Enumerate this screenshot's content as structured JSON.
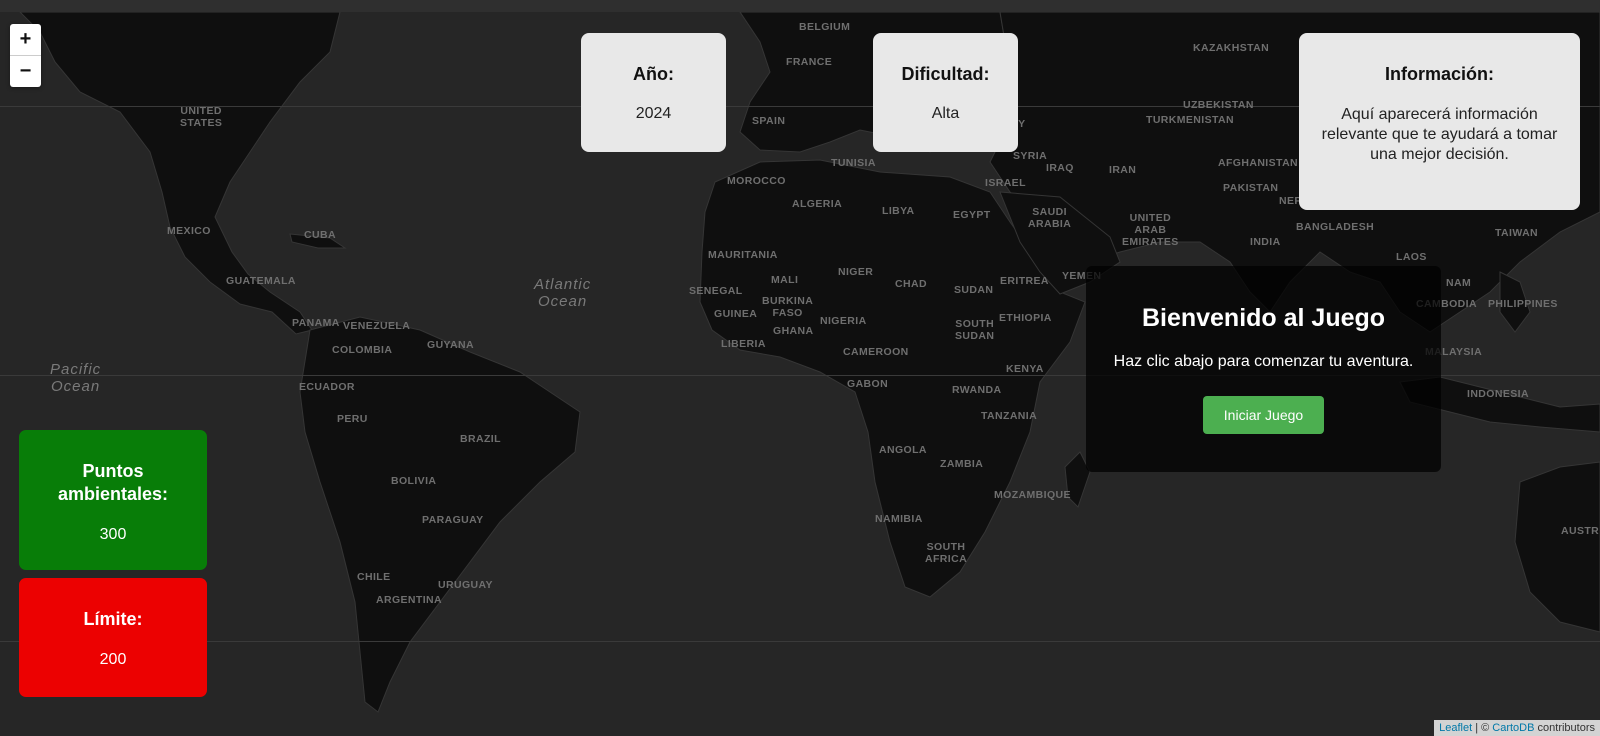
{
  "map": {
    "zoom_in_label": "+",
    "zoom_out_label": "−",
    "countries": [
      {
        "key": "united-states",
        "label": "UNITED\nSTATES",
        "l": 180,
        "t": 105
      },
      {
        "key": "mexico",
        "label": "MEXICO",
        "l": 167,
        "t": 225
      },
      {
        "key": "cuba",
        "label": "CUBA",
        "l": 304,
        "t": 229
      },
      {
        "key": "guatemala",
        "label": "GUATEMALA",
        "l": 226,
        "t": 275
      },
      {
        "key": "panama",
        "label": "PANAMA",
        "l": 292,
        "t": 317
      },
      {
        "key": "venezuela",
        "label": "VENEZUELA",
        "l": 343,
        "t": 320
      },
      {
        "key": "guyana",
        "label": "GUYANA",
        "l": 427,
        "t": 339
      },
      {
        "key": "colombia",
        "label": "COLOMBIA",
        "l": 332,
        "t": 344
      },
      {
        "key": "ecuador",
        "label": "ECUADOR",
        "l": 299,
        "t": 381
      },
      {
        "key": "peru",
        "label": "PERU",
        "l": 337,
        "t": 413
      },
      {
        "key": "brazil",
        "label": "BRAZIL",
        "l": 460,
        "t": 433
      },
      {
        "key": "bolivia",
        "label": "BOLIVIA",
        "l": 391,
        "t": 475
      },
      {
        "key": "paraguay",
        "label": "PARAGUAY",
        "l": 422,
        "t": 514
      },
      {
        "key": "uruguay",
        "label": "URUGUAY",
        "l": 438,
        "t": 579
      },
      {
        "key": "chile",
        "label": "CHILE",
        "l": 357,
        "t": 571
      },
      {
        "key": "argentina",
        "label": "ARGENTINA",
        "l": 376,
        "t": 594
      },
      {
        "key": "belgium",
        "label": "BELGIUM",
        "l": 799,
        "t": 21
      },
      {
        "key": "france",
        "label": "FRANCE",
        "l": 786,
        "t": 56
      },
      {
        "key": "spain",
        "label": "SPAIN",
        "l": 752,
        "t": 115
      },
      {
        "key": "tunisia",
        "label": "TUNISIA",
        "l": 831,
        "t": 157
      },
      {
        "key": "morocco",
        "label": "MOROCCO",
        "l": 727,
        "t": 175
      },
      {
        "key": "algeria",
        "label": "ALGERIA",
        "l": 792,
        "t": 198
      },
      {
        "key": "libya",
        "label": "LIBYA",
        "l": 882,
        "t": 205
      },
      {
        "key": "egypt",
        "label": "EGYPT",
        "l": 953,
        "t": 209
      },
      {
        "key": "mauritania",
        "label": "MAURITANIA",
        "l": 708,
        "t": 249
      },
      {
        "key": "mali",
        "label": "MALI",
        "l": 771,
        "t": 274
      },
      {
        "key": "niger",
        "label": "NIGER",
        "l": 838,
        "t": 266
      },
      {
        "key": "chad",
        "label": "CHAD",
        "l": 895,
        "t": 278
      },
      {
        "key": "sudan",
        "label": "SUDAN",
        "l": 954,
        "t": 284
      },
      {
        "key": "senegal",
        "label": "SENEGAL",
        "l": 689,
        "t": 285
      },
      {
        "key": "burkina-faso",
        "label": "BURKINA\nFASO",
        "l": 762,
        "t": 295
      },
      {
        "key": "guinea",
        "label": "GUINEA",
        "l": 714,
        "t": 308
      },
      {
        "key": "nigeria",
        "label": "NIGERIA",
        "l": 820,
        "t": 315
      },
      {
        "key": "ghana",
        "label": "GHANA",
        "l": 773,
        "t": 325
      },
      {
        "key": "liberia",
        "label": "LIBERIA",
        "l": 721,
        "t": 338
      },
      {
        "key": "cameroon",
        "label": "CAMEROON",
        "l": 843,
        "t": 346
      },
      {
        "key": "south-sudan",
        "label": "SOUTH\nSUDAN",
        "l": 955,
        "t": 318
      },
      {
        "key": "ethiopia",
        "label": "ETHIOPIA",
        "l": 999,
        "t": 312
      },
      {
        "key": "eritrea",
        "label": "ERITREA",
        "l": 1000,
        "t": 275
      },
      {
        "key": "kenya",
        "label": "KENYA",
        "l": 1006,
        "t": 363
      },
      {
        "key": "gabon",
        "label": "GABON",
        "l": 847,
        "t": 378
      },
      {
        "key": "rwanda",
        "label": "RWANDA",
        "l": 952,
        "t": 384
      },
      {
        "key": "tanzania",
        "label": "TANZANIA",
        "l": 981,
        "t": 410
      },
      {
        "key": "angola",
        "label": "ANGOLA",
        "l": 879,
        "t": 444
      },
      {
        "key": "zambia",
        "label": "ZAMBIA",
        "l": 940,
        "t": 458
      },
      {
        "key": "mozambique",
        "label": "MOZAMBIQUE",
        "l": 994,
        "t": 489
      },
      {
        "key": "namibia",
        "label": "NAMIBIA",
        "l": 875,
        "t": 513
      },
      {
        "key": "south-africa",
        "label": "SOUTH\nAFRICA",
        "l": 925,
        "t": 541
      },
      {
        "key": "turkey",
        "label": "TURKEY",
        "l": 980,
        "t": 118
      },
      {
        "key": "syria",
        "label": "SYRIA",
        "l": 1013,
        "t": 150
      },
      {
        "key": "iraq",
        "label": "IRAQ",
        "l": 1046,
        "t": 162
      },
      {
        "key": "israel",
        "label": "ISRAEL",
        "l": 985,
        "t": 177
      },
      {
        "key": "saudi-arabia",
        "label": "SAUDI\nARABIA",
        "l": 1028,
        "t": 206
      },
      {
        "key": "yemen",
        "label": "YEMEN",
        "l": 1062,
        "t": 270
      },
      {
        "key": "iran",
        "label": "IRAN",
        "l": 1109,
        "t": 164
      },
      {
        "key": "kazakhstan",
        "label": "KAZAKHSTAN",
        "l": 1193,
        "t": 42
      },
      {
        "key": "uzbekistan",
        "label": "UZBEKISTAN",
        "l": 1183,
        "t": 99
      },
      {
        "key": "turkmenistan",
        "label": "TURKMENISTAN",
        "l": 1146,
        "t": 114
      },
      {
        "key": "afghanistan",
        "label": "AFGHANISTAN",
        "l": 1218,
        "t": 157
      },
      {
        "key": "pakistan",
        "label": "PAKISTAN",
        "l": 1223,
        "t": 182
      },
      {
        "key": "nepal",
        "label": "NEPAL",
        "l": 1279,
        "t": 195
      },
      {
        "key": "uae",
        "label": "UNITED\nARAB\nEMIRATES",
        "l": 1122,
        "t": 212
      },
      {
        "key": "bangladesh",
        "label": "BANGLADESH",
        "l": 1296,
        "t": 221
      },
      {
        "key": "india",
        "label": "INDIA",
        "l": 1250,
        "t": 236
      },
      {
        "key": "laos",
        "label": "LAOS",
        "l": 1396,
        "t": 251
      },
      {
        "key": "vietnam",
        "label": "NAM",
        "l": 1446,
        "t": 277
      },
      {
        "key": "cambodia",
        "label": "CAMBODIA",
        "l": 1416,
        "t": 298
      },
      {
        "key": "malaysia",
        "label": "MALAYSIA",
        "l": 1425,
        "t": 346
      },
      {
        "key": "philippines",
        "label": "PHILIPPINES",
        "l": 1488,
        "t": 298
      },
      {
        "key": "taiwan",
        "label": "TAIWAN",
        "l": 1495,
        "t": 227
      },
      {
        "key": "indonesia",
        "label": "INDONESIA",
        "l": 1467,
        "t": 388
      },
      {
        "key": "australia",
        "label": "AUSTR",
        "l": 1561,
        "t": 525
      }
    ],
    "oceans": [
      {
        "key": "atlantic",
        "label": "Atlantic\nOcean",
        "l": 534,
        "t": 276
      },
      {
        "key": "pacific",
        "label": "Pacific\nOcean",
        "l": 50,
        "t": 361
      }
    ],
    "attribution": {
      "leaflet": "Leaflet",
      "sep": " | © ",
      "carto": "CartoDB",
      "rest": " contributors"
    }
  },
  "cards": {
    "year": {
      "heading": "Año:",
      "value": "2024"
    },
    "difficulty": {
      "heading": "Dificultad:",
      "value": "Alta"
    },
    "info": {
      "heading": "Información:",
      "text": "Aquí aparecerá información relevante que te ayudará a tomar una mejor decisión."
    }
  },
  "stats": {
    "points": {
      "heading": "Puntos ambientales:",
      "value": "300",
      "color": "#087d08"
    },
    "limit": {
      "heading": "Límite:",
      "value": "200",
      "color": "#ec0101"
    }
  },
  "welcome": {
    "title": "Bienvenido al Juego",
    "subtitle": "Haz clic abajo para comenzar tu aventura.",
    "button": "Iniciar Juego"
  }
}
